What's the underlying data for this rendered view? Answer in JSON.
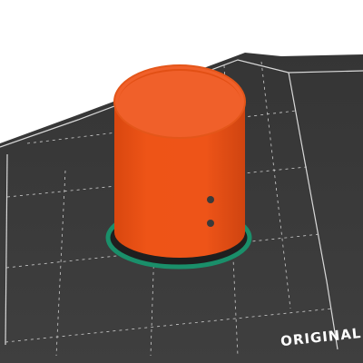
{
  "viewport": {
    "bed_brand_text": "ORIGINAL",
    "colors": {
      "background": "#ffffff",
      "bed_surface": "#3b3b3b",
      "bed_surface_light": "#454545",
      "grid_lines": "#cfcfcf",
      "bed_border": "#d9d9d9",
      "bed_lip": "#222222",
      "model_body": "#ea5016",
      "model_inner": "#f0602a",
      "model_shadow": "#c8410f",
      "footprint_outline": "#1a8f6a",
      "brand_text": "#ffffff"
    },
    "objects": [
      {
        "name": "cylinder-model",
        "selected": false
      }
    ]
  }
}
